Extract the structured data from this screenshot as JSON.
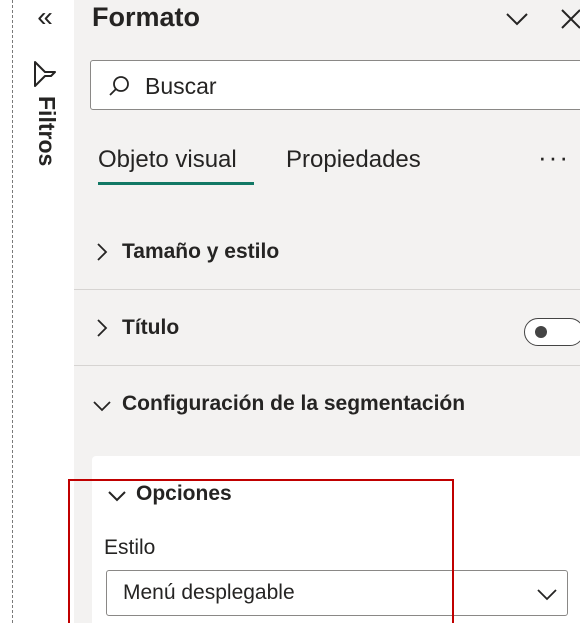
{
  "filters_pane": {
    "collapse_icon": "double-chevron-left-icon",
    "funnel_icon": "filter-funnel-icon",
    "label": "Filtros"
  },
  "format_pane": {
    "title": "Formato",
    "search": {
      "placeholder": "Buscar",
      "icon": "search-icon"
    },
    "tabs": [
      {
        "label": "Objeto visual",
        "active": true
      },
      {
        "label": "Propiedades",
        "active": false
      }
    ],
    "more_label": "···",
    "sections": [
      {
        "label": "Tamaño y estilo",
        "expanded": false
      },
      {
        "label": "Título",
        "expanded": false,
        "toggle": "off"
      },
      {
        "label": "Configuración de la segmentación",
        "expanded": true
      }
    ],
    "options_card": {
      "label": "Opciones",
      "expanded": true,
      "style_label": "Estilo",
      "style_value": "Menú desplegable"
    }
  },
  "colors": {
    "pane_bg": "#f3f2f1",
    "active_tab_underline": "#117865",
    "highlight_border": "#c00000"
  }
}
